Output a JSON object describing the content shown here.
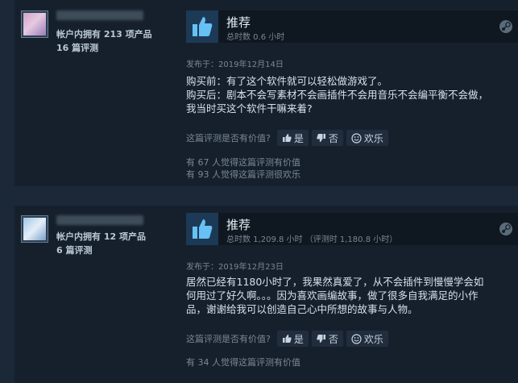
{
  "reviews": [
    {
      "products_owned": "帐户内拥有 213 项产品",
      "reviews_count": "16 篇评测",
      "recommendation": "推荐",
      "hours": "总时数 0.6 小时",
      "date": "发布于：2019年12月14日",
      "body_lines": [
        "购买前：有了这个软件就可以轻松做游戏了。",
        "购买后：剧本不会写素材不会画插件不会用音乐不会编平衡不会做，",
        "我当时买这个软件干嘛来着?"
      ],
      "helpful_question": "这篇评测是否有价值?",
      "yes_label": "是",
      "no_label": "否",
      "funny_label": "欢乐",
      "stats": [
        "有 67 人觉得这篇评测有价值",
        "有 93 人觉得这篇评测很欢乐"
      ]
    },
    {
      "products_owned": "帐户内拥有 12 项产品",
      "reviews_count": "6 篇评测",
      "recommendation": "推荐",
      "hours": "总时数 1,209.8 小时  （评测时 1,180.8 小时）",
      "date": "发布于：2019年12月23日",
      "body_lines": [
        "居然已经有1180小时了，我果然真爱了，从不会插件到慢慢学会如",
        "何用过了好久啊。。。因为喜欢画编故事，做了很多自我满足的小作",
        "品，谢谢给我可以创造自己心中所想的故事与人物。"
      ],
      "helpful_question": "这篇评测是否有价值?",
      "yes_label": "是",
      "no_label": "否",
      "funny_label": "欢乐",
      "stats": [
        "有 34 人觉得这篇评测有价值"
      ]
    }
  ],
  "icons": {
    "thumb": "thumbs-up-icon",
    "platform": "steam-icon",
    "vote_yes": "thumbs-up-icon",
    "vote_no": "thumbs-down-icon",
    "vote_funny": "smiley-icon"
  },
  "colors": {
    "background": "#1b2838",
    "card": "#16202d",
    "accent": "#67c1f5",
    "muted": "#7a8794"
  }
}
